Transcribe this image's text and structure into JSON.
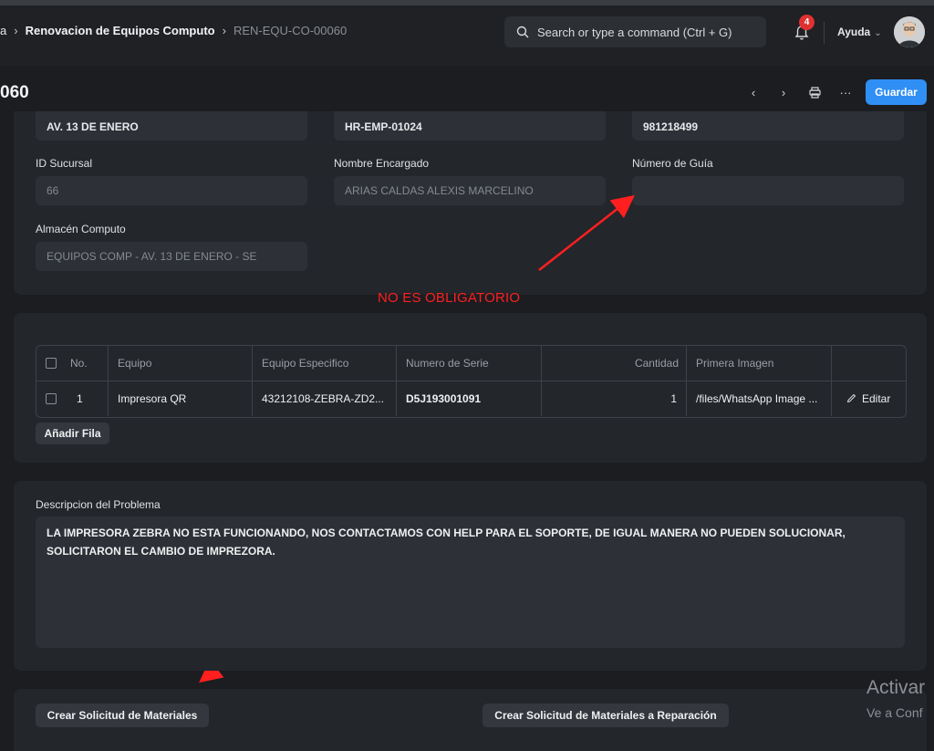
{
  "breadcrumbs": {
    "items": [
      "a",
      "Renovacion de Equipos Computo",
      "REN-EQU-CO-00060"
    ]
  },
  "search": {
    "placeholder": "Search or type a command (Ctrl + G)"
  },
  "notifications": {
    "count": "4"
  },
  "help": {
    "label": "Ayuda"
  },
  "document": {
    "title": "060",
    "save_label": "Guardar"
  },
  "fields": {
    "row0": {
      "col1": "AV. 13 DE ENERO",
      "col2": "HR-EMP-01024",
      "col3": "981218499"
    },
    "branch_id": {
      "label": "ID Sucursal",
      "value": "66"
    },
    "manager": {
      "label": "Nombre Encargado",
      "value": "ARIAS CALDAS ALEXIS MARCELINO"
    },
    "guide": {
      "label": "Número de Guía",
      "value": ""
    },
    "warehouse": {
      "label": "Almacén Computo",
      "value": "EQUIPOS COMP - AV. 13 DE ENERO - SE"
    }
  },
  "annotation": {
    "text": "NO ES OBLIGATORIO"
  },
  "table": {
    "columns": [
      "No.",
      "Equipo",
      "Equipo Especifico",
      "Numero de Serie",
      "Cantidad",
      "Primera Imagen"
    ],
    "rows": [
      {
        "no": "1",
        "equipo": "Impresora QR",
        "especifico": "43212108-ZEBRA-ZD2...",
        "serie": "D5J193001091",
        "cantidad": "1",
        "imagen": "/files/WhatsApp Image ...",
        "edit": "Editar"
      }
    ],
    "add_row": "Añadir Fila"
  },
  "problem": {
    "label": "Descripcion del Problema",
    "text": "LA IMPRESORA ZEBRA NO ESTA FUNCIONANDO, NOS CONTACTAMOS CON HELP PARA EL SOPORTE, DE IGUAL MANERA NO PUEDEN SOLUCIONAR, SOLICITARON EL CAMBIO DE IMPREZORA."
  },
  "actions": {
    "create_request": "Crear Solicitud de Materiales",
    "create_repair_request": "Crear Solicitud de Materiales a Reparación"
  },
  "watermark": {
    "line1": "Activar",
    "line2": "Ve a Conf"
  },
  "colors": {
    "accent": "#2f8ff5",
    "annotation": "#ff1f1f",
    "badge": "#e03131"
  }
}
